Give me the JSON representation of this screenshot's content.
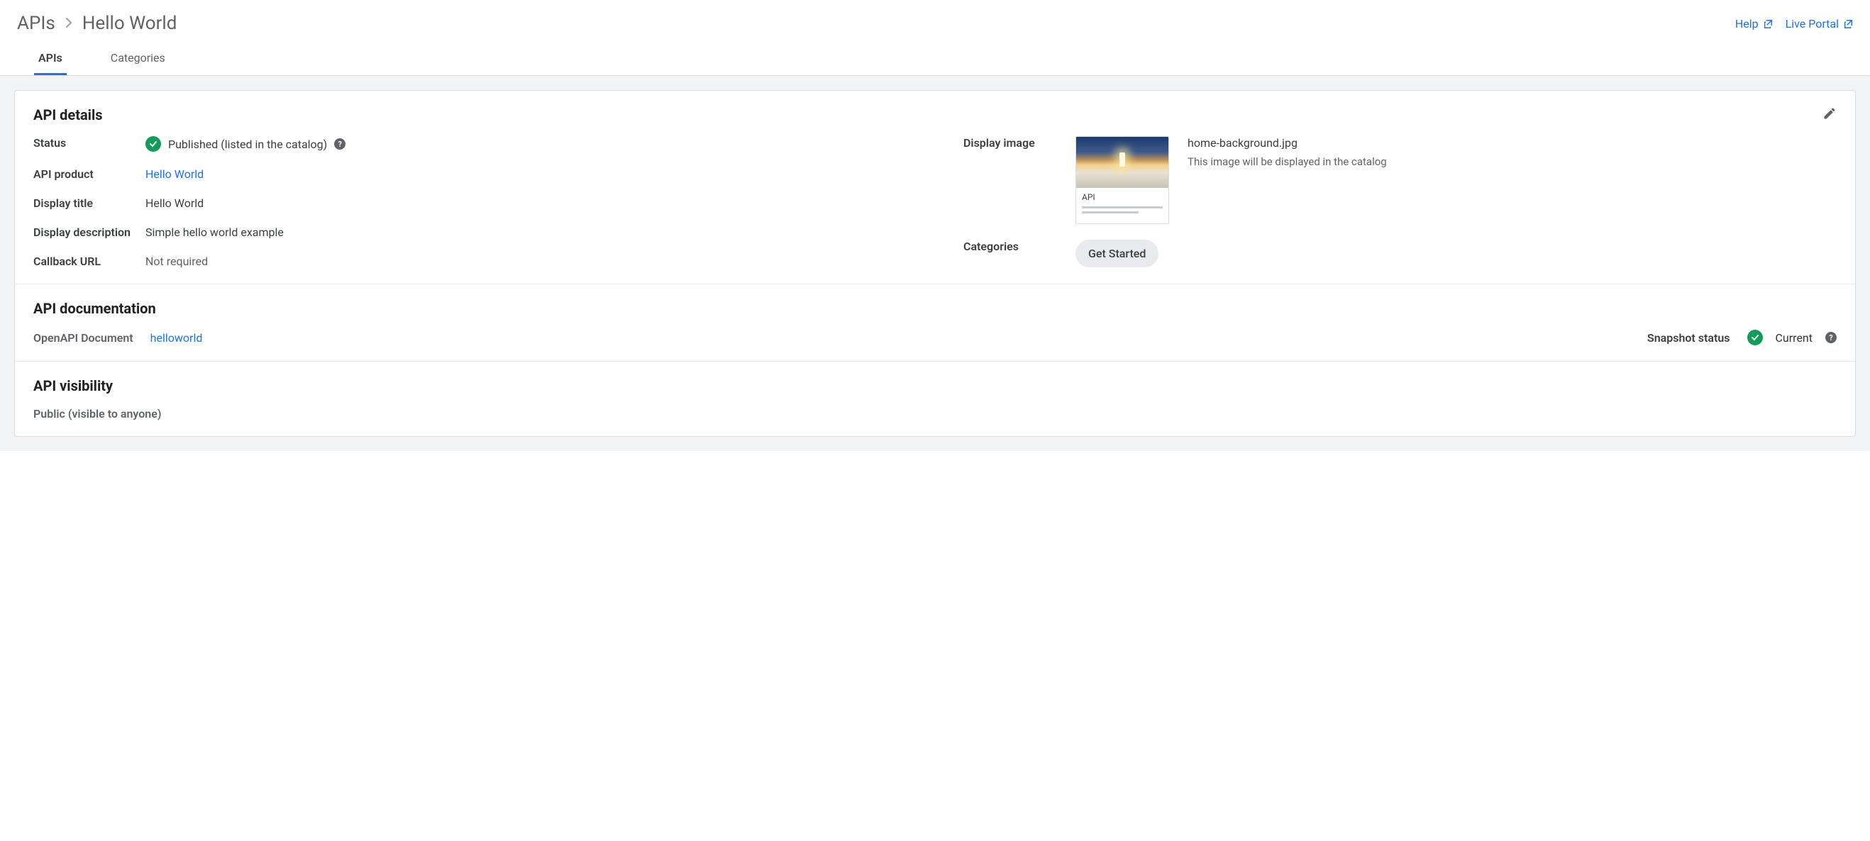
{
  "breadcrumb": {
    "root": "APIs",
    "current": "Hello World"
  },
  "header_links": {
    "help": "Help",
    "live_portal": "Live Portal"
  },
  "tabs": {
    "apis": "APIs",
    "categories": "Categories"
  },
  "details": {
    "title": "API details",
    "status_label": "Status",
    "status_value": "Published (listed in the catalog)",
    "api_product_label": "API product",
    "api_product_value": "Hello World",
    "display_title_label": "Display title",
    "display_title_value": "Hello World",
    "display_description_label": "Display description",
    "display_description_value": "Simple hello world example",
    "callback_url_label": "Callback URL",
    "callback_url_value": "Not required",
    "display_image_label": "Display image",
    "display_image_filename": "home-background.jpg",
    "display_image_caption": "This image will be displayed in the catalog",
    "thumb_title": "API",
    "categories_label": "Categories",
    "categories_chip": "Get Started"
  },
  "documentation": {
    "title": "API documentation",
    "openapi_label": "OpenAPI Document",
    "openapi_value": "helloworld",
    "snapshot_label": "Snapshot status",
    "snapshot_value": "Current"
  },
  "visibility": {
    "title": "API visibility",
    "value": "Public (visible to anyone)"
  }
}
